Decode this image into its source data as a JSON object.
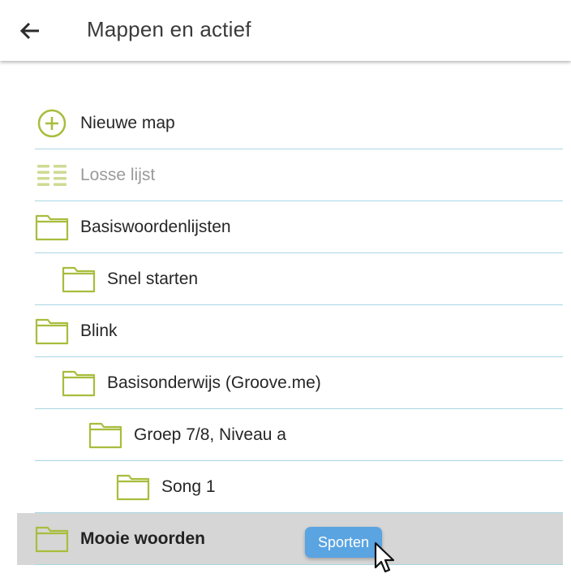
{
  "header": {
    "title": "Mappen en actief",
    "back_icon": "arrow-left-icon"
  },
  "colors": {
    "accent": "#a8bd3c",
    "divider": "#a9d6e3",
    "selected_row": "#d6d6d6",
    "chip": "#5aa4e2"
  },
  "list": {
    "items": [
      {
        "label": "Nieuwe map",
        "icon": "add-circle-icon"
      },
      {
        "label": "Losse lijst",
        "icon": "list-icon"
      },
      {
        "label": "Basiswoordenlijsten",
        "icon": "folder-icon"
      },
      {
        "label": "Snel starten",
        "icon": "folder-icon"
      },
      {
        "label": "Blink",
        "icon": "folder-icon"
      },
      {
        "label": "Basisonderwijs (Groove.me)",
        "icon": "folder-icon"
      },
      {
        "label": "Groep 7/8, Niveau a",
        "icon": "folder-icon"
      },
      {
        "label": "Song 1",
        "icon": "folder-icon"
      },
      {
        "label": "Mooie woorden",
        "icon": "folder-icon"
      }
    ]
  },
  "drag_chip": {
    "label": "Sporten"
  }
}
